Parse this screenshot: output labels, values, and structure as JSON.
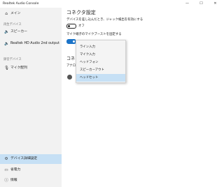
{
  "window": {
    "title": "Realtek Audio Console",
    "controls": [
      "—",
      "☐",
      "✕"
    ]
  },
  "sidebar": {
    "menu": {
      "icon": "home-icon",
      "label": "メイン"
    },
    "playback_section": "再生デバイス",
    "playback_items": [
      {
        "icon": "speaker-icon",
        "label": "スピーカー"
      },
      {
        "icon": "speaker-icon",
        "label": "Realtek HD Audio 2nd output"
      }
    ],
    "recording_section": "録音デバイス",
    "recording_items": [
      {
        "icon": "microphone-icon",
        "label": "マイク配列"
      }
    ],
    "bottom_items": [
      {
        "icon": "gear-icon",
        "label": "デバイス詳細設定",
        "selected": true
      },
      {
        "icon": "battery-icon",
        "label": "省電力"
      },
      {
        "icon": "info-icon",
        "label": "情報"
      }
    ]
  },
  "main": {
    "title": "コネクタ設定",
    "option1_label": "デバイスを差し込んだとき、ジャック検出を有効にする",
    "option1_state": "オフ",
    "option2_label": "マイク端子のマイクブーストを固定する",
    "hidden_title": "コネ",
    "hidden_label": "アナロ",
    "dropdown_options": [
      "ライン入力",
      "マイク入力",
      "ヘッドフォン",
      "スピーカーアウト",
      "ヘッドセット"
    ],
    "dropdown_selected": "ヘッドセット"
  },
  "colors": {
    "accent": "#1a73c8",
    "selection": "#c6e0f5",
    "sidebar_bg": "#f2f2f2"
  }
}
